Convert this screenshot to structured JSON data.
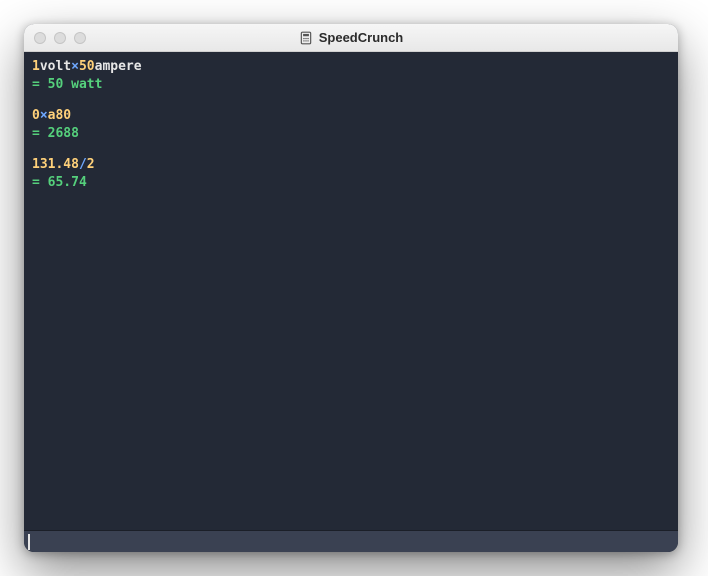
{
  "window": {
    "title": "SpeedCrunch"
  },
  "history": [
    {
      "expr": [
        {
          "t": "1",
          "kind": "num"
        },
        {
          "t": "volt",
          "kind": "unit"
        },
        {
          "t": "×",
          "kind": "op"
        },
        {
          "t": "50",
          "kind": "num"
        },
        {
          "t": "ampere",
          "kind": "unit"
        }
      ],
      "result": "= 50 watt"
    },
    {
      "expr": [
        {
          "t": "0",
          "kind": "num"
        },
        {
          "t": "×",
          "kind": "op"
        },
        {
          "t": "a80",
          "kind": "num"
        }
      ],
      "result": "= 2688"
    },
    {
      "expr": [
        {
          "t": "131.48",
          "kind": "num"
        },
        {
          "t": "/",
          "kind": "op"
        },
        {
          "t": "2",
          "kind": "num"
        }
      ],
      "result": "= 65.74"
    }
  ],
  "input": {
    "value": ""
  }
}
